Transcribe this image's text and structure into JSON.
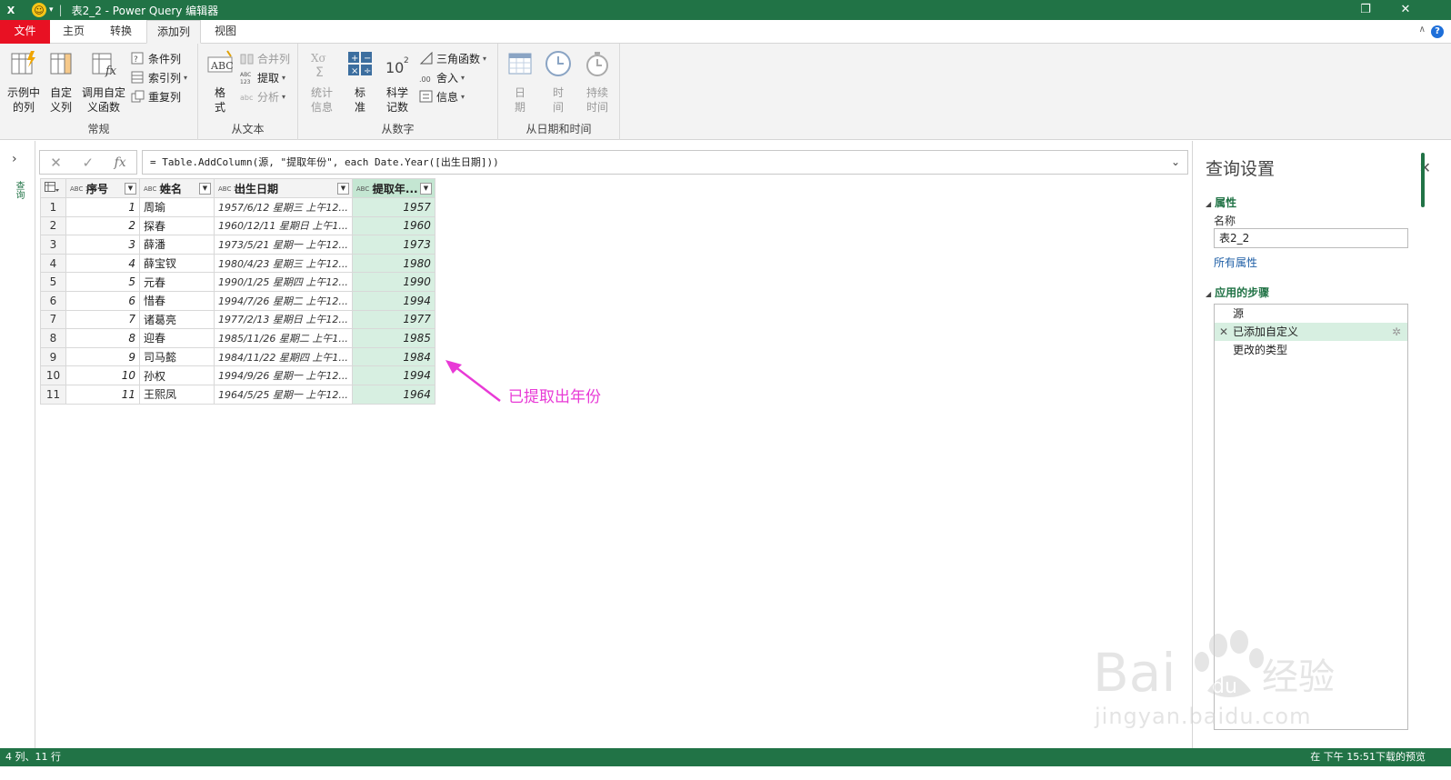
{
  "titlebar": {
    "app_logo": "X",
    "quick_access": "▾",
    "title": "表2_2 - Power Query 编辑器"
  },
  "tabs": {
    "file": "文件",
    "home": "主页",
    "transform": "转换",
    "add_column": "添加列",
    "view": "视图"
  },
  "ribbon": {
    "general": {
      "label": "常规",
      "column_from_examples": "示例中\n的列",
      "custom_column": "自定\n义列",
      "invoke_function": "调用自定\n义函数",
      "conditional_column": "条件列",
      "index_column": "索引列",
      "duplicate_column": "重复列"
    },
    "from_text": {
      "label": "从文本",
      "format": "格\n式",
      "merge_columns": "合并列",
      "extract": "提取",
      "parse": "分析"
    },
    "from_number": {
      "label": "从数字",
      "statistics": "统计\n信息",
      "standard": "标\n准",
      "scientific": "科学\n记数",
      "trigonometry": "三角函数",
      "rounding": "舍入",
      "information": "信息"
    },
    "from_datetime": {
      "label": "从日期和时间",
      "date": "日\n期",
      "time": "时\n间",
      "duration": "持续\n时间"
    }
  },
  "leftnav": {
    "label": "查询"
  },
  "formula": {
    "text": "= Table.AddColumn(源, \"提取年份\", each Date.Year([出生日期]))"
  },
  "table": {
    "columns": [
      "序号",
      "姓名",
      "出生日期",
      "提取年..."
    ],
    "type_label": "ABC\n123",
    "rows": [
      [
        "1",
        "周瑜",
        "1957/6/12 星期三 上午12...",
        "1957"
      ],
      [
        "2",
        "探春",
        "1960/12/11 星期日 上午1...",
        "1960"
      ],
      [
        "3",
        "薛潘",
        "1973/5/21 星期一 上午12...",
        "1973"
      ],
      [
        "4",
        "薛宝钗",
        "1980/4/23 星期三 上午12...",
        "1980"
      ],
      [
        "5",
        "元春",
        "1990/1/25 星期四 上午12...",
        "1990"
      ],
      [
        "6",
        "惜春",
        "1994/7/26 星期二 上午12...",
        "1994"
      ],
      [
        "7",
        "诸葛亮",
        "1977/2/13 星期日 上午12...",
        "1977"
      ],
      [
        "8",
        "迎春",
        "1985/11/26 星期二 上午1...",
        "1985"
      ],
      [
        "9",
        "司马懿",
        "1984/11/22 星期四 上午1...",
        "1984"
      ],
      [
        "10",
        "孙权",
        "1994/9/26 星期一 上午12...",
        "1994"
      ],
      [
        "11",
        "王熙凤",
        "1964/5/25 星期一 上午12...",
        "1964"
      ]
    ]
  },
  "annotation": {
    "text": "已提取出年份",
    "color": "#e83ad6"
  },
  "query_settings": {
    "title": "查询设置",
    "properties": "属性",
    "name_label": "名称",
    "name_value": "表2_2",
    "all_properties": "所有属性",
    "applied_steps": "应用的步骤",
    "steps": [
      "源",
      "已添加自定义",
      "更改的类型"
    ]
  },
  "status": {
    "left": "4 列、11 行",
    "right": "在 下午 15:51下载的预览"
  },
  "watermark": {
    "brand": "Bai",
    "brand2": "du",
    "brand3": "经验",
    "url": "jingyan.baidu.com"
  },
  "colors": {
    "accent": "#217346",
    "file_tab": "#e81123",
    "highlight": "#d7efe1"
  }
}
